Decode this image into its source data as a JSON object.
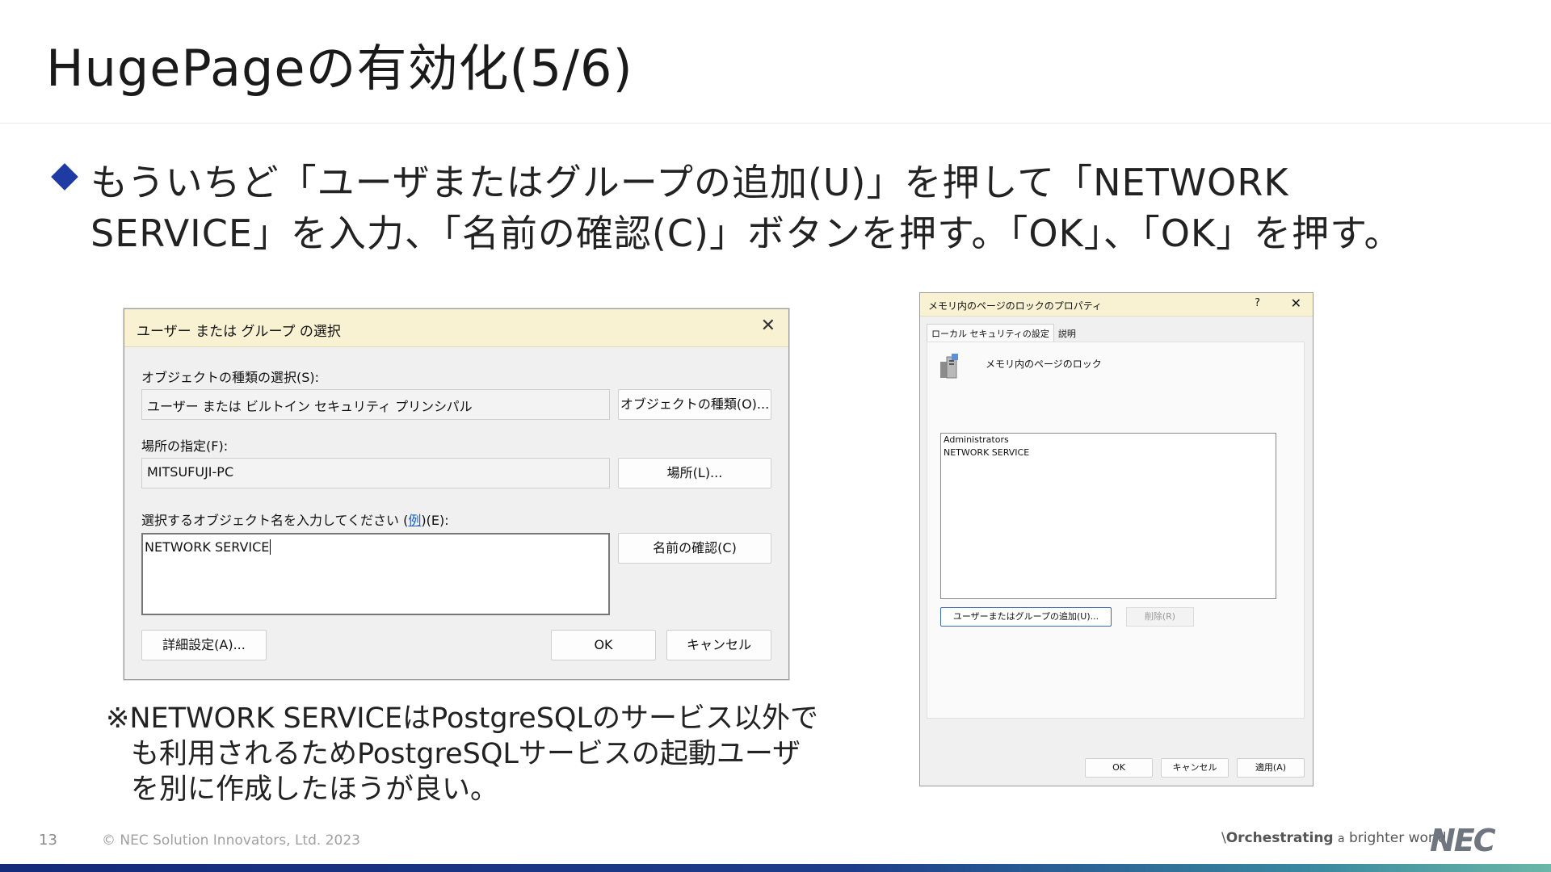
{
  "slide": {
    "title": "HugePageの有効化(5/6)",
    "instruction_line1": "もういちど「ユーザまたはグループの追加(U)」を押して「NETWORK",
    "instruction_line2": "SERVICE」を入力、「名前の確認(C)」ボタンを押す。「OK」、「OK」を押す。",
    "note_line1": "※NETWORK SERVICEはPostgreSQLのサービス以外で",
    "note_line2": "も利用されるためPostgreSQLサービスの起動ユーザ",
    "note_line3": "を別に作成したほうが良い。",
    "page_number": "13",
    "copyright": "© NEC Solution Innovators, Ltd. 2023",
    "tagline_bold": "Orchestrating",
    "tagline_a": "a",
    "tagline_rest": "brighter world",
    "logo": "NEC",
    "accent_color": "#1f3aa3"
  },
  "select_dialog": {
    "title": "ユーザー または グループ の選択",
    "object_type_label": "オブジェクトの種類の選択(S):",
    "object_type_value": "ユーザー または ビルトイン セキュリティ プリンシパル",
    "object_type_button": "オブジェクトの種類(O)...",
    "location_label": "場所の指定(F):",
    "location_value": "MITSUFUJI-PC",
    "location_button": "場所(L)...",
    "object_name_label": "選択するオブジェクト名を入力してください (",
    "object_name_example_link": "例",
    "object_name_label_end": ")(E):",
    "object_name_value": "NETWORK SERVICE",
    "check_names_button": "名前の確認(C)",
    "advanced_button": "詳細設定(A)...",
    "ok_button": "OK",
    "cancel_button": "キャンセル"
  },
  "props_dialog": {
    "title": "メモリ内のページのロックのプロパティ",
    "help": "?",
    "tab_local": "ローカル セキュリティの設定",
    "tab_explain": "説明",
    "policy_name": "メモリ内のページのロック",
    "list_items": [
      "Administrators",
      "NETWORK SERVICE"
    ],
    "add_button": "ユーザーまたはグループの追加(U)...",
    "remove_button": "削除(R)",
    "ok_button": "OK",
    "cancel_button": "キャンセル",
    "apply_button": "適用(A)"
  }
}
